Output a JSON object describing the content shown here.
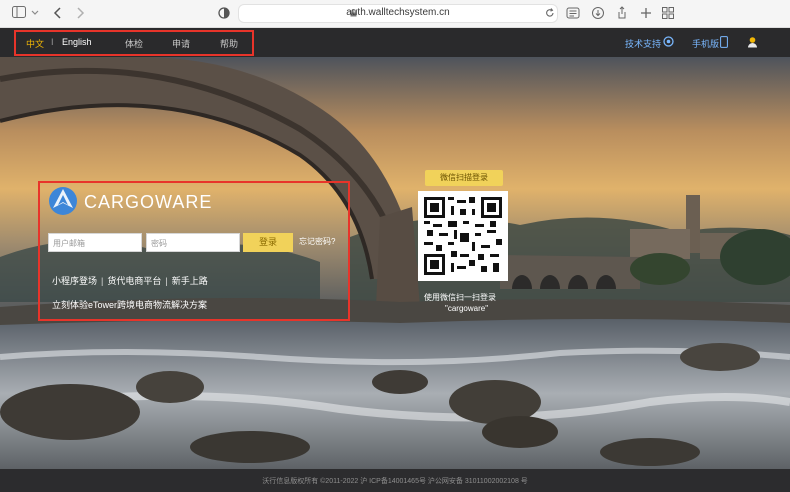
{
  "browser": {
    "url": "auth.walltechsystem.cn",
    "icons": [
      "sidebar-icon",
      "chevron-down-icon",
      "back-icon",
      "forward-icon",
      "privacy-shield-icon",
      "lock-icon",
      "reload-icon",
      "reader-icon",
      "downloads-icon",
      "share-icon",
      "new-tab-icon",
      "tab-overview-icon"
    ]
  },
  "nav": {
    "lang_zh": "中文",
    "lang_divider": "I",
    "lang_en": "English",
    "items": [
      "体检",
      "申请",
      "帮助"
    ],
    "support": "技术支持",
    "mobile": "手机版",
    "accent_color": "#f2b705"
  },
  "login": {
    "brand": "CARGOWARE",
    "username_placeholder": "用户邮箱",
    "password_placeholder": "密码",
    "login_button": "登录",
    "forgot": "忘记密码?",
    "links": [
      "小程序登场",
      "货代电商平台",
      "新手上路"
    ],
    "promo": "立刻体验eTower跨境电商物流解决方案"
  },
  "qr": {
    "badge": "微信扫描登录",
    "caption_line1": "使用微信扫一扫登录",
    "caption_line2": "\"cargoware\""
  },
  "footer": {
    "text": "沃行信息版权所有 ©2011-2022 沪 ICP备14001465号 沪公网安备 31011002002108 号"
  }
}
